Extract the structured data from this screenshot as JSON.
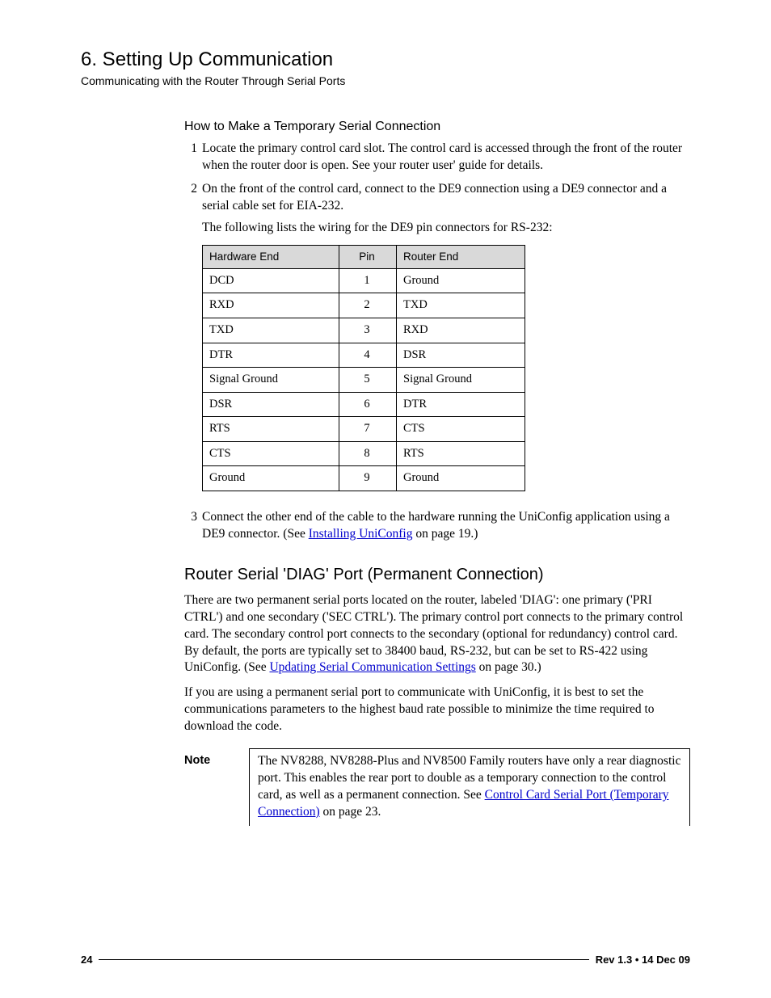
{
  "chapter": {
    "title": "6. Setting Up Communication",
    "subtitle": "Communicating with the Router Through Serial Ports"
  },
  "section1": {
    "heading": "How to Make a Temporary Serial Connection",
    "step1": "Locate the primary control card slot. The control card is accessed through the front of the router when the router door is open. See your router user' guide for details.",
    "step2": "On the front of the control card, connect to the DE9 connection using a DE9 connector and a serial cable set for EIA-232.",
    "step2_follow": "The following lists the wiring for the DE9 pin connectors for RS-232:",
    "table": {
      "headers": {
        "hw": "Hardware End",
        "pin": "Pin",
        "re": "Router End"
      },
      "rows": [
        {
          "hw": "DCD",
          "pin": "1",
          "re": "Ground"
        },
        {
          "hw": "RXD",
          "pin": "2",
          "re": "TXD"
        },
        {
          "hw": "TXD",
          "pin": "3",
          "re": "RXD"
        },
        {
          "hw": "DTR",
          "pin": "4",
          "re": "DSR"
        },
        {
          "hw": "Signal Ground",
          "pin": "5",
          "re": "Signal Ground"
        },
        {
          "hw": "DSR",
          "pin": "6",
          "re": "DTR"
        },
        {
          "hw": "RTS",
          "pin": "7",
          "re": "CTS"
        },
        {
          "hw": "CTS",
          "pin": "8",
          "re": "RTS"
        },
        {
          "hw": "Ground",
          "pin": "9",
          "re": "Ground"
        }
      ]
    },
    "step3_a": "Connect the other end of the cable to the hardware running the UniConfig application using a DE9 connector. (See ",
    "step3_link": "Installing UniConfig",
    "step3_b": " on page 19.)"
  },
  "section2": {
    "heading": "Router Serial 'DIAG' Port (Permanent Connection)",
    "p1_a": "There are two permanent serial ports located on the router, labeled 'DIAG': one primary ('PRI CTRL') and one secondary ('SEC CTRL'). The primary control port connects to the primary control card. The secondary control port connects to the secondary (optional for redundancy) control card. By default, the ports are typically set to 38400 baud, RS-232, but can be set to RS-422 using UniConfig. (See ",
    "p1_link": "Updating Serial Communication Settings",
    "p1_b": " on page 30.)",
    "p2": "If you are using a permanent serial port to communicate with UniConfig, it is best to set the communications parameters to the highest baud rate possible to minimize the time required to download the code.",
    "note_label": "Note",
    "note_a": "The NV8288, NV8288-Plus and NV8500 Family routers have only a rear diagnostic port. This enables the rear port to double as a temporary connection to the control card, as well as a permanent connection. See ",
    "note_link": "Control Card Serial Port (Temporary Connection)",
    "note_b": " on page 23."
  },
  "footer": {
    "page": "24",
    "rev": "Rev 1.3 • 14 Dec 09"
  }
}
